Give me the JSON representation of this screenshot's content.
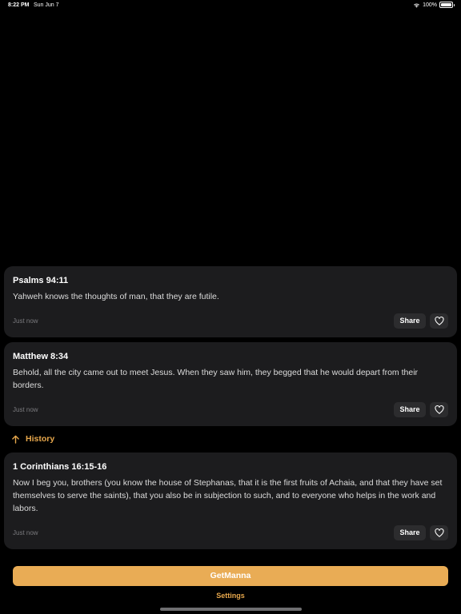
{
  "status_bar": {
    "time": "8:22 PM",
    "date": "Sun Jun 7",
    "battery": "100%"
  },
  "cards": [
    {
      "reference": "Psalms 94:11",
      "text": "Yahweh knows the thoughts of man, that they are futile.",
      "timestamp": "Just now",
      "share_label": "Share"
    },
    {
      "reference": "Matthew 8:34",
      "text": "Behold, all the city came out to meet Jesus. When they saw him, they begged that he would depart from their borders.",
      "timestamp": "Just now",
      "share_label": "Share"
    },
    {
      "reference": "1 Corinthians 16:15-16",
      "text": "Now I beg you, brothers (you know the house of Stephanas, that it is the first fruits of Achaia, and that they have set themselves to serve the saints), that you also be in subjection to such, and to everyone who helps in the work and labors.",
      "timestamp": "Just now",
      "share_label": "Share"
    }
  ],
  "history": {
    "label": "History",
    "icon": "arrow-up-icon"
  },
  "actions": {
    "getmanna_label": "GetManna",
    "settings_label": "Settings"
  },
  "colors": {
    "accent": "#e9ac55",
    "card_bg": "#1c1c1e",
    "button_bg": "#2c2c2e",
    "background": "#000000"
  }
}
